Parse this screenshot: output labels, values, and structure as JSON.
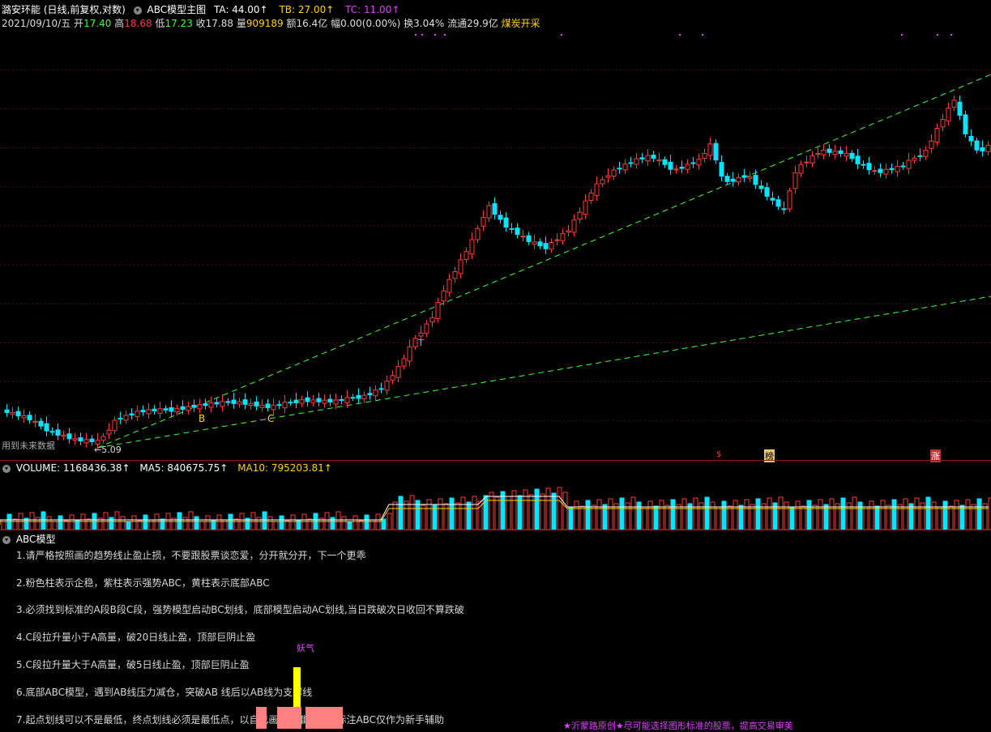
{
  "header": {
    "stock_name": "潞安环能",
    "chart_mode": "(日线,前复权,对数)",
    "indicator_name": "ABC模型主图",
    "ta": "TA: 44.00↑",
    "tb": "TB: 27.00↑",
    "tc": "TC: 11.00↑"
  },
  "quote": {
    "date": "2021/09/10/五",
    "open_label": "开",
    "open": "17.40",
    "high_label": "高",
    "high": "18.68",
    "low_label": "低",
    "low": "17.23",
    "close_label": "收",
    "close": "17.88",
    "volume_label": "量",
    "volume": "909189",
    "amount": "额16.4亿",
    "change": "幅0.00(0.00%)",
    "turnover": "换3.04%",
    "float": "流通29.9亿",
    "concept": "煤炭开采"
  },
  "main_chart": {
    "future_data_note": "用到未来数据",
    "low_price_label": "5.09",
    "marker_b": "B",
    "marker_c": "C",
    "marker_t": "T",
    "badge_s": "$",
    "badge_bang": "榜",
    "badge_zhang": "涨",
    "colors": {
      "up": "#ff3c3c",
      "down": "#00e5ff",
      "trend": "#3cff3c"
    }
  },
  "volume_panel": {
    "title": "VOLUME: 1168436.38↑",
    "ma5": "MA5: 840675.75↑",
    "ma10": "MA10: 795203.81↑"
  },
  "abc_panel": {
    "title": "ABC模型",
    "notes": [
      "1.请严格按照画的趋势线止盈止损，不要跟股票谈恋爱，分开就分开，下一个更乖",
      "2.粉色柱表示企稳，紫柱表示强势ABC，黄柱表示底部ABC",
      "3.必须找到标准的A段B段C段，强势模型启动BC划线，底部模型启动AC划线,当日跌破次日收回不算跌破",
      "4.C段拉升量小于A高量，破20日线止盈，顶部巨阴止盈",
      "5.C段拉升量大于A高量，破5日线止盈，顶部巨阴止盈",
      "6.底部ABC模型，遇到AB线压力减仓，突破AB 线后以AB线为支撑线",
      "7.起点划线可以不是最低，终点划线必须是最低点，以自己画线为准，软件标注ABC仅作为新手辅助"
    ],
    "yaoqi_label": "妖气",
    "footer": "★沂蒙路原创★尽可能选择图形标准的股票，提高交易审美"
  }
}
